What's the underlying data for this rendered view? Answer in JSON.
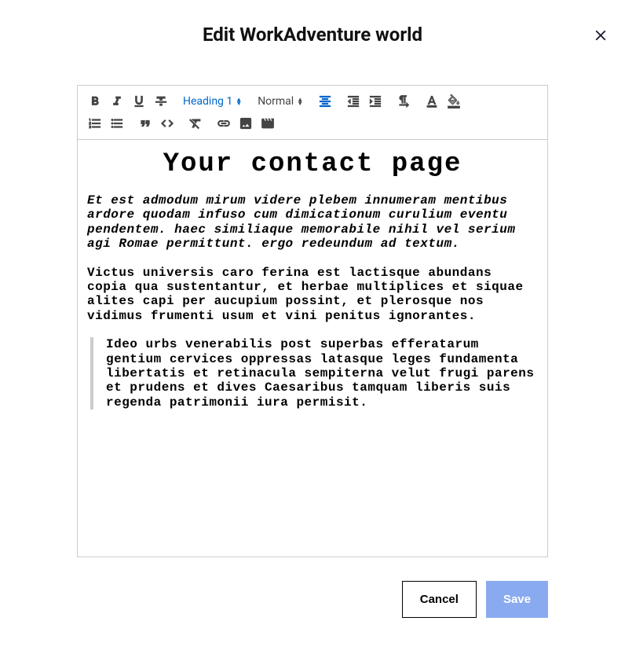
{
  "modal": {
    "title": "Edit WorkAdventure world"
  },
  "toolbar": {
    "heading_select": "Heading 1",
    "size_select": "Normal"
  },
  "content": {
    "heading": "Your contact page",
    "para1": "Et est admodum mirum videre plebem innumeram mentibus ardore quodam infuso cum dimicationum curulium eventu pendentem. haec similiaque memorabile nihil vel serium agi Romae permittunt. ergo redeundum ad textum.",
    "para2": "Victus universis caro ferina est lactisque abundans copia qua sustentantur, et herbae multiplices et siquae alites capi per aucupium possint, et plerosque nos vidimus frumenti usum et vini penitus ignorantes.",
    "quote": "Ideo urbs venerabilis post superbas efferatarum gentium cervices oppressas latasque leges fundamenta libertatis et retinacula sempiterna velut frugi parens et prudens et dives Caesaribus tamquam liberis suis regenda patrimonii iura permisit."
  },
  "footer": {
    "cancel": "Cancel",
    "save": "Save"
  }
}
